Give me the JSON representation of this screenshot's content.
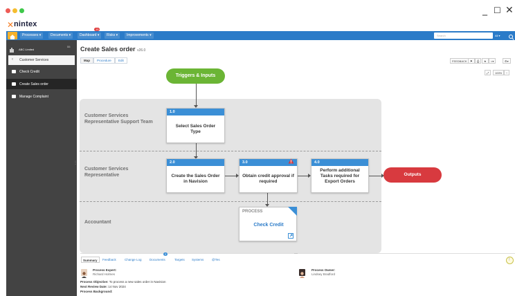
{
  "window": {
    "colors": {
      "close": "#ee5b55",
      "minimize": "#f5bd2f",
      "maximize": "#3ec84a"
    },
    "minimize_glyph": "_",
    "maximize_glyph": "☐",
    "close_glyph": "✕"
  },
  "brand": {
    "logo_mark": "✕",
    "name": "nintex"
  },
  "nav": {
    "items": [
      "Processes ▾",
      "Documents ▾",
      "Dashboard ▾",
      "Risks ▾",
      "Improvements ▾"
    ],
    "dashboard_badge": "15",
    "search_placeholder": "Search",
    "search_scope": "All ▾",
    "search_icon": "search-icon",
    "accent": "#2b7bc8"
  },
  "sidebar": {
    "header_label": "ABC Limited",
    "header_count": "55",
    "back_label": "Customer Services",
    "items": [
      {
        "label": "Check Credit",
        "selected": false
      },
      {
        "label": "Create Sales order",
        "selected": true
      },
      {
        "label": "Manage Complaint",
        "selected": false
      }
    ]
  },
  "page": {
    "title": "Create Sales order",
    "version": "v26.0",
    "tabs": [
      "Map",
      "Procedure",
      "Edit"
    ],
    "toolbar": {
      "feedback": "FEEDBACK",
      "zoom": "100%"
    }
  },
  "diagram": {
    "start": {
      "label": "Triggers & Inputs",
      "color": "#6bb535"
    },
    "end": {
      "label": "Outputs",
      "color": "#d83a3f"
    },
    "lanes": [
      "Customer Services Representative Support Team",
      "Customer Services Representative",
      "Accountant"
    ],
    "activities": [
      {
        "number": "1.0",
        "text": "Select Sales Order Type",
        "warning": false
      },
      {
        "number": "2.0",
        "text": "Create the Sales Order in Navision",
        "warning": false
      },
      {
        "number": "3.0",
        "text": "Obtain credit approval if required",
        "warning": true
      },
      {
        "number": "4.0",
        "text": "Perform additional Tasks required for Export Orders",
        "warning": false
      }
    ],
    "process_link": {
      "tag": "PROCESS",
      "label": "Check Credit"
    }
  },
  "bottom": {
    "tabs": [
      "Summary",
      "Feedback",
      "Change Log",
      "Documents",
      "Targets",
      "Systems",
      "@Tes"
    ],
    "documents_badge": "2",
    "expert_label": "Process Expert:",
    "expert_name": "Richard Holmes",
    "owner_label": "Process Owner:",
    "owner_name": "Lindsey Bradford",
    "objective_label": "Process Objective:",
    "objective_text": "To process a new sales order in Navision",
    "review_label": "Next Review Date:",
    "review_text": "14 Nov 2024",
    "background_label": "Process Background:"
  }
}
